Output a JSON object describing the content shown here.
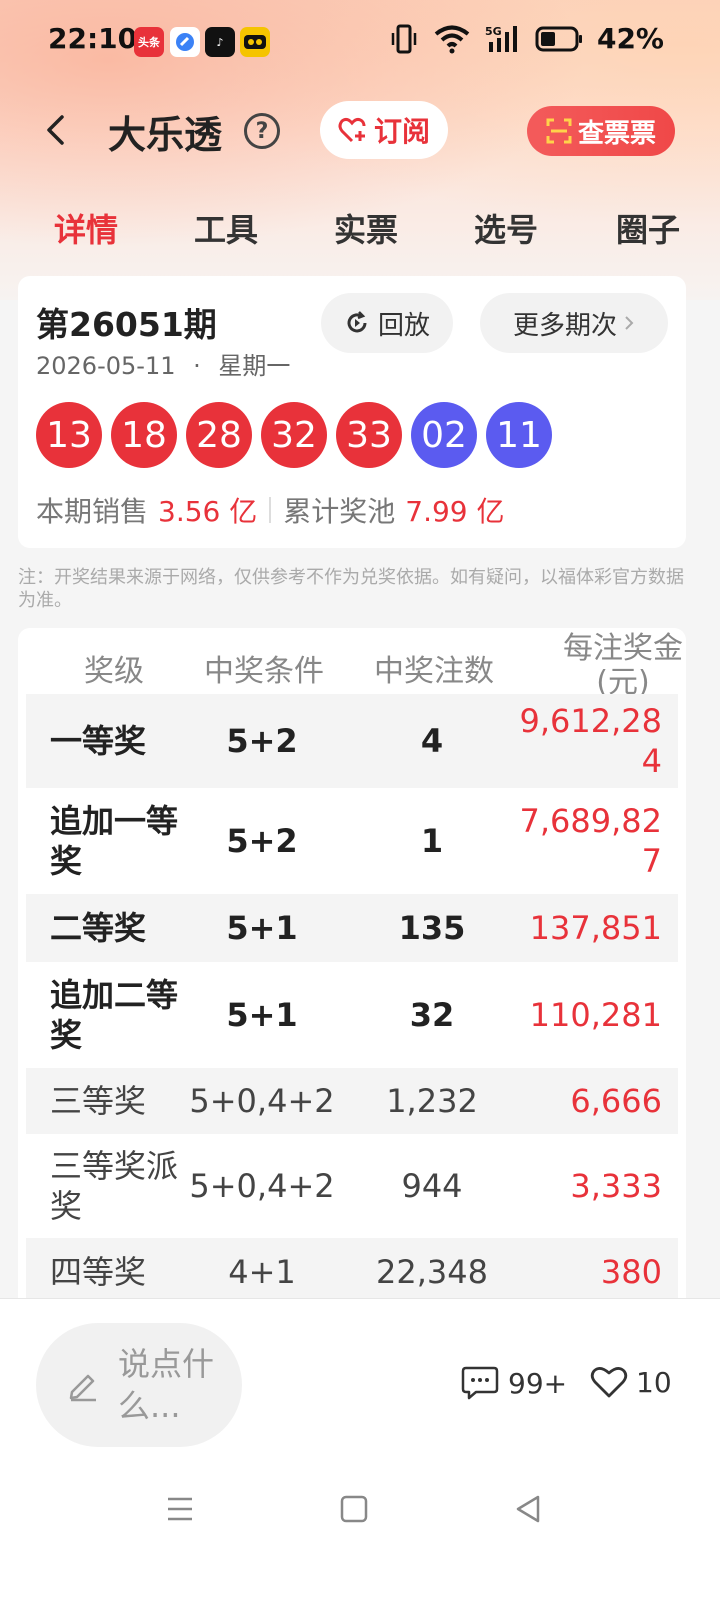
{
  "status_bar": {
    "time": "22:10",
    "battery": "42%",
    "network": "5G",
    "notifications": [
      {
        "name": "toutiao-app-icon",
        "label": "头条",
        "color": "#e8323a"
      },
      {
        "name": "blue-app-icon",
        "label": "",
        "color": "#3b82f6"
      },
      {
        "name": "tiktok-app-icon",
        "label": "♪",
        "color": "#111111"
      },
      {
        "name": "yellow-app-icon",
        "label": "",
        "color": "#f5c400"
      }
    ]
  },
  "header": {
    "title": "大乐透",
    "help_symbol": "?",
    "subscribe_label": "订阅",
    "check_ticket_label": "查票票"
  },
  "tabs": [
    {
      "label": "详情",
      "active": true
    },
    {
      "label": "工具",
      "active": false
    },
    {
      "label": "实票",
      "active": false
    },
    {
      "label": "选号",
      "active": false
    },
    {
      "label": "圈子",
      "active": false
    }
  ],
  "draw": {
    "issue": "第26051期",
    "date": "2026-05-11",
    "dot": "·",
    "weekday": "星期一",
    "replay_label": "回放",
    "more_label": "更多期次",
    "red_balls": [
      "13",
      "18",
      "28",
      "32",
      "33"
    ],
    "blue_balls": [
      "02",
      "11"
    ],
    "red_color": "#e8323a",
    "blue_color": "#5b5bf0",
    "sales_label": "本期销售",
    "sales_value": "3.56 亿",
    "pool_label": "累计奖池",
    "pool_value": "7.99 亿"
  },
  "note": "注：开奖结果来源于网络，仅供参考不作为兑奖依据。如有疑问，以福体彩官方数据为准。",
  "prize_table": {
    "headers": [
      "奖级",
      "中奖条件",
      "中奖注数",
      "每注奖金(元)"
    ],
    "rows": [
      {
        "level": "一等奖",
        "condition": "5+2",
        "count": "4",
        "amount": "9,612,284"
      },
      {
        "level": "追加一等奖",
        "condition": "5+2",
        "count": "1",
        "amount": "7,689,827"
      },
      {
        "level": "二等奖",
        "condition": "5+1",
        "count": "135",
        "amount": "137,851"
      },
      {
        "level": "追加二等奖",
        "condition": "5+1",
        "count": "32",
        "amount": "110,281"
      },
      {
        "level": "三等奖",
        "condition": "5+0,4+2",
        "count": "1,232",
        "amount": "6,666"
      },
      {
        "level": "三等奖派奖",
        "condition": "5+0,4+2",
        "count": "944",
        "amount": "3,333"
      },
      {
        "level": "四等奖",
        "condition": "4+1",
        "count": "22,348",
        "amount": "380"
      }
    ]
  },
  "bottom": {
    "comment_placeholder": "说点什么...",
    "comment_count": "99+",
    "like_count": "10"
  }
}
